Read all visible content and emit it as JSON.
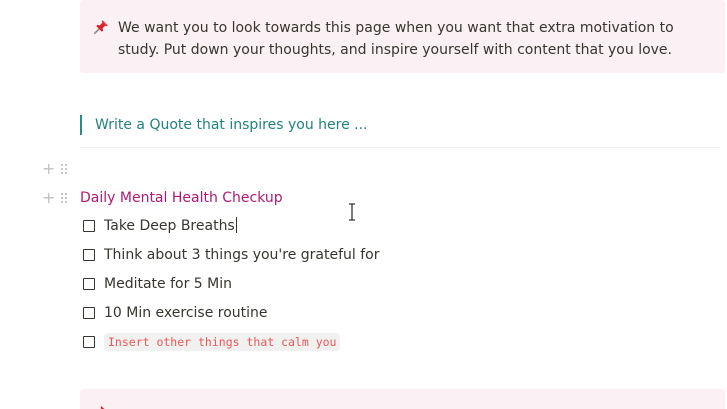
{
  "callout": {
    "icon": "pushpin-icon",
    "text": "We want you to look towards this page when you want that extra motivation to study. Put down your thoughts, and inspire yourself with content that you love."
  },
  "quote": {
    "placeholder": "Write a Quote that inspires you here ..."
  },
  "checkup": {
    "heading": "Daily Mental Health Checkup",
    "items": [
      {
        "label": "Take Deep Breaths",
        "checked": false
      },
      {
        "label": "Think about 3 things you're grateful for",
        "checked": false
      },
      {
        "label": "Meditate for 5 Min",
        "checked": false
      },
      {
        "label": "10 Min exercise routine",
        "checked": false
      },
      {
        "label": "Insert other things that calm you",
        "checked": false,
        "style": "inline-code"
      }
    ]
  },
  "colors": {
    "callout_bg": "#fbf1f4",
    "quote_text": "#22807f",
    "heading_text": "#ad1a72",
    "code_text": "#eb5757"
  }
}
